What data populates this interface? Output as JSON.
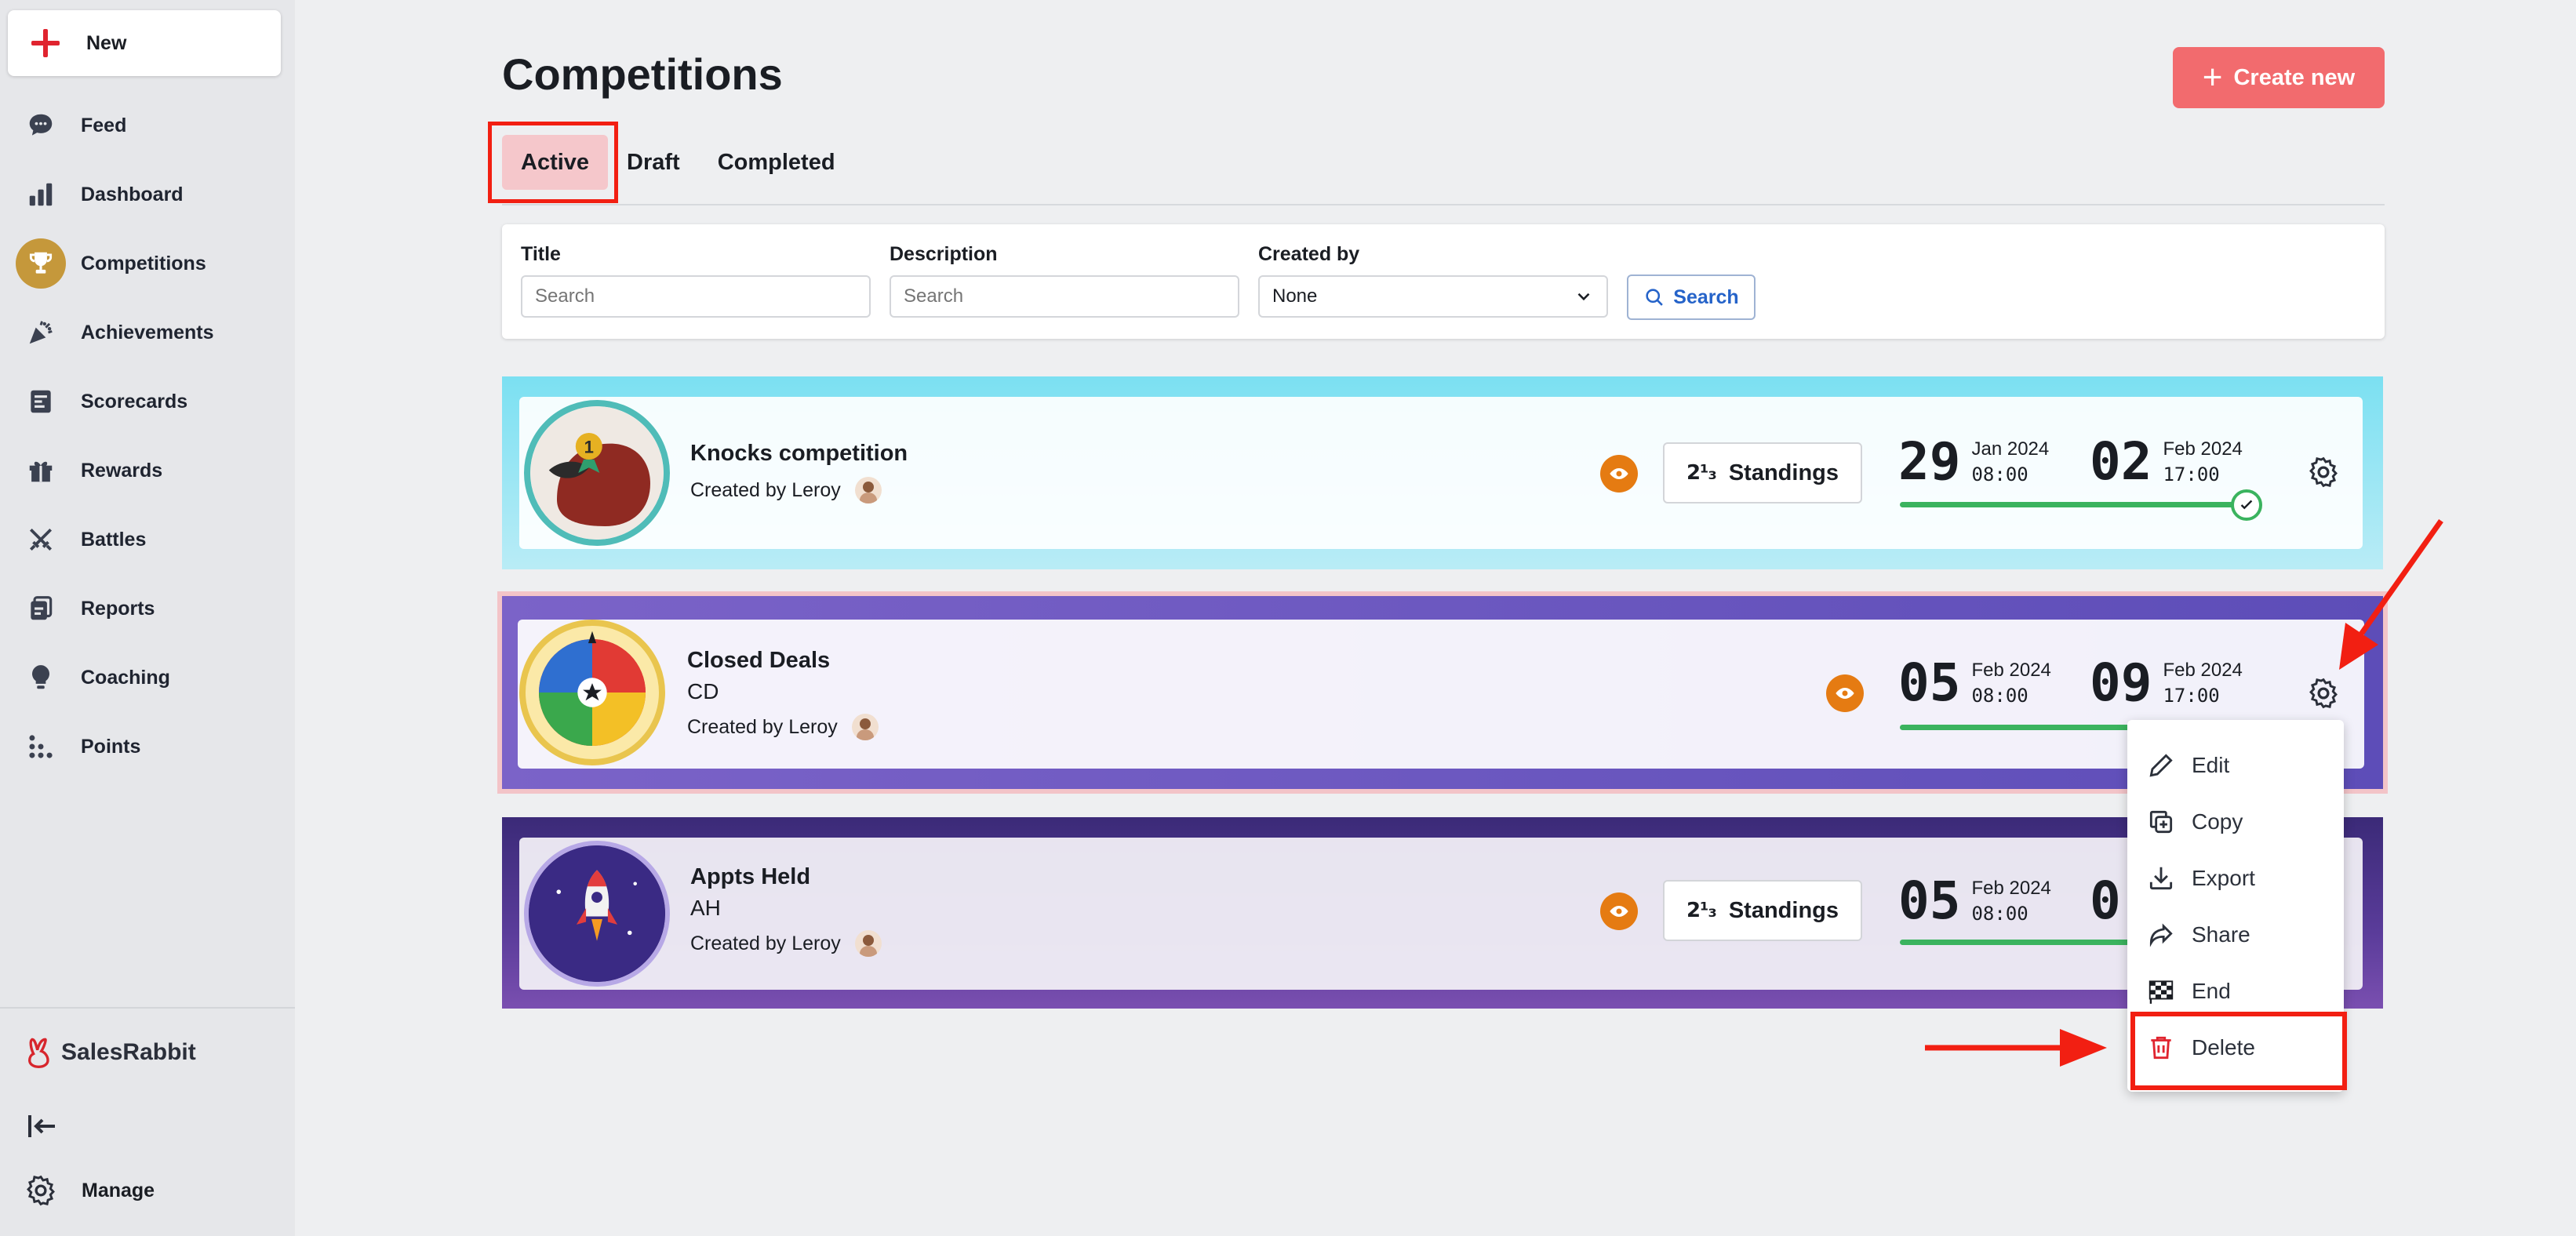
{
  "sidebar": {
    "new_label": "New",
    "items": [
      {
        "label": "Feed",
        "icon": "chat-bubble-icon"
      },
      {
        "label": "Dashboard",
        "icon": "bar-chart-icon"
      },
      {
        "label": "Competitions",
        "icon": "trophy-icon",
        "active": true
      },
      {
        "label": "Achievements",
        "icon": "party-popper-icon"
      },
      {
        "label": "Scorecards",
        "icon": "scorecard-icon"
      },
      {
        "label": "Rewards",
        "icon": "gift-icon"
      },
      {
        "label": "Battles",
        "icon": "crossed-swords-icon"
      },
      {
        "label": "Reports",
        "icon": "reports-icon"
      },
      {
        "label": "Coaching",
        "icon": "lightbulb-icon"
      },
      {
        "label": "Points",
        "icon": "dots-grid-icon"
      }
    ],
    "brand": "SalesRabbit",
    "manage_label": "Manage"
  },
  "header": {
    "title": "Competitions",
    "create_label": "Create new"
  },
  "tabs": [
    {
      "label": "Active",
      "active": true
    },
    {
      "label": "Draft"
    },
    {
      "label": "Completed"
    }
  ],
  "filters": {
    "title_label": "Title",
    "title_placeholder": "Search",
    "description_label": "Description",
    "description_placeholder": "Search",
    "created_by_label": "Created by",
    "created_by_value": "None",
    "search_label": "Search"
  },
  "competitions": [
    {
      "name": "Knocks competition",
      "code": "",
      "created_by": "Created by Leroy",
      "standings_label": "Standings",
      "start_day": "29",
      "start_month": "Jan 2024",
      "start_time": "08:00",
      "end_day": "02",
      "end_month": "Feb 2024",
      "end_time": "17:00",
      "progress": 1.0
    },
    {
      "name": "Closed Deals",
      "code": "CD",
      "created_by": "Created by Leroy",
      "start_day": "05",
      "start_month": "Feb 2024",
      "start_time": "08:00",
      "end_day": "09",
      "end_month": "Feb 2024",
      "end_time": "17:00",
      "progress": 1.0
    },
    {
      "name": "Appts Held",
      "code": "AH",
      "created_by": "Created by Leroy",
      "standings_label": "Standings",
      "start_day": "05",
      "start_month": "Feb 2024",
      "start_time": "08:00",
      "end_day": "0"
    }
  ],
  "menu": {
    "items": [
      {
        "label": "Edit",
        "icon": "pencil-icon"
      },
      {
        "label": "Copy",
        "icon": "copy-icon"
      },
      {
        "label": "Export",
        "icon": "download-icon"
      },
      {
        "label": "Share",
        "icon": "share-icon"
      },
      {
        "label": "End",
        "icon": "checkered-flag-icon"
      },
      {
        "label": "Delete",
        "icon": "trash-icon"
      }
    ]
  },
  "colors": {
    "accent": "#f26b6e",
    "highlight": "#f21f12",
    "active_tab": "#f5c7cb",
    "progress": "#3bb35e",
    "eye_badge": "#e57b12"
  },
  "standings_glyph": "2¹₃"
}
